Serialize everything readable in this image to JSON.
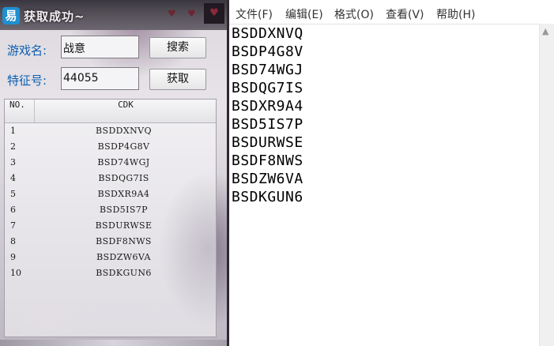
{
  "tool_window": {
    "title": "获取成功~",
    "game_name_label": "游戏名:",
    "game_name_value": "战意",
    "search_button": "搜索",
    "feature_code_label": "特征号:",
    "feature_code_value": "44055",
    "fetch_button": "获取",
    "columns": [
      "NO.",
      "CDK"
    ],
    "rows": [
      {
        "no": "1",
        "cdk": "BSDDXNVQ"
      },
      {
        "no": "2",
        "cdk": "BSDP4G8V"
      },
      {
        "no": "3",
        "cdk": "BSD74WGJ"
      },
      {
        "no": "4",
        "cdk": "BSDQG7IS"
      },
      {
        "no": "5",
        "cdk": "BSDXR9A4"
      },
      {
        "no": "6",
        "cdk": "BSD5IS7P"
      },
      {
        "no": "7",
        "cdk": "BSDURWSE"
      },
      {
        "no": "8",
        "cdk": "BSDF8NWS"
      },
      {
        "no": "9",
        "cdk": "BSDZW6VA"
      },
      {
        "no": "10",
        "cdk": "BSDKGUN6"
      }
    ]
  },
  "notepad": {
    "menu": [
      "文件(F)",
      "编辑(E)",
      "格式(O)",
      "查看(V)",
      "帮助(H)"
    ],
    "lines": [
      "BSDDXNVQ",
      "BSDP4G8V",
      "BSD74WGJ",
      "BSDQG7IS",
      "BSDXR9A4",
      "BSD5IS7P",
      "BSDURWSE",
      "BSDF8NWS",
      "BSDZW6VA",
      "BSDKGUN6"
    ]
  },
  "colors": {
    "label_blue": "#0b5fb2",
    "app_icon": "#1e8fd0"
  }
}
